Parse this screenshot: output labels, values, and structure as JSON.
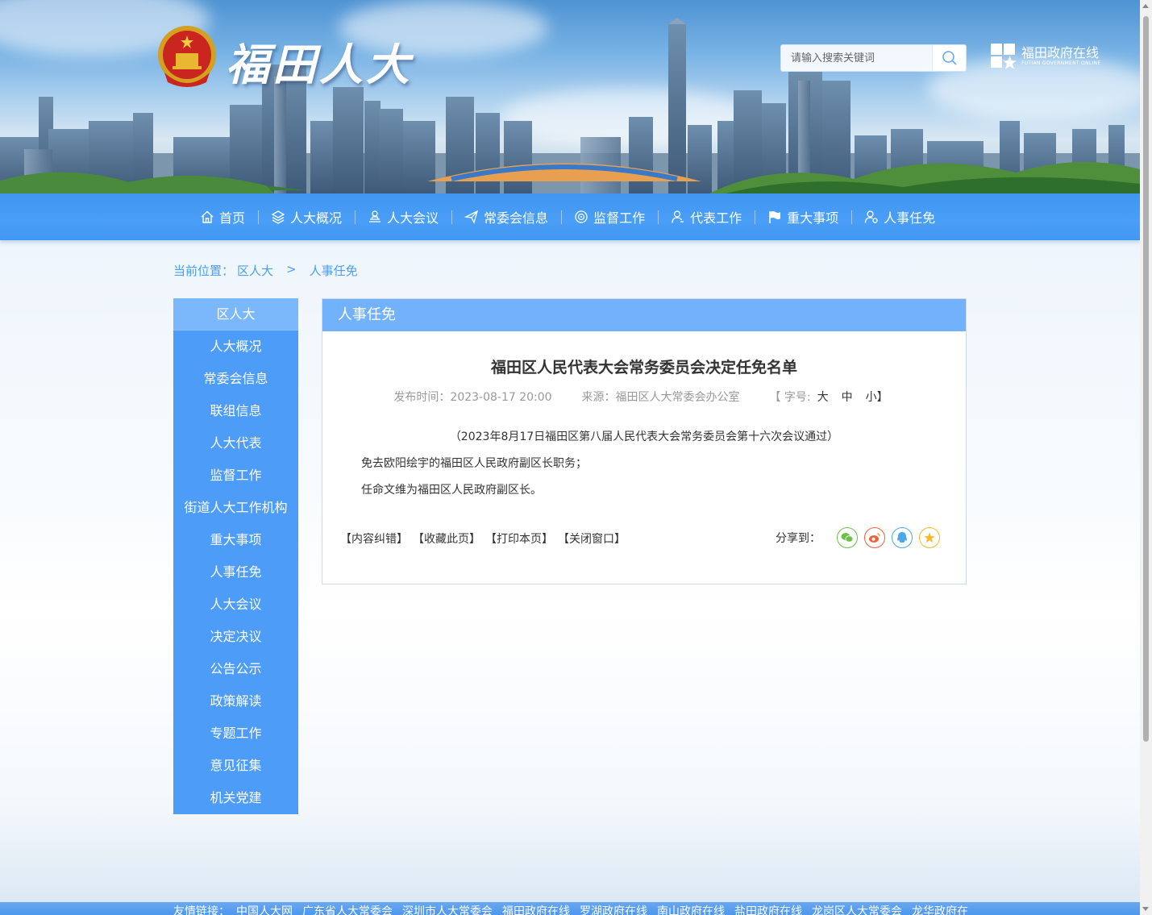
{
  "header": {
    "logo_text": "福田人大",
    "search": {
      "placeholder": "请输入搜索关键词"
    },
    "gov_logo": {
      "name": "福田政府在线",
      "subtitle": "FUTIAN GOVERNMENT ONLINE"
    }
  },
  "nav": [
    {
      "label": "首页",
      "icon": "home-icon"
    },
    {
      "label": "人大概况",
      "icon": "layers-icon"
    },
    {
      "label": "人大会议",
      "icon": "meeting-icon"
    },
    {
      "label": "常委会信息",
      "icon": "send-icon"
    },
    {
      "label": "监督工作",
      "icon": "eye-icon"
    },
    {
      "label": "代表工作",
      "icon": "user-icon"
    },
    {
      "label": "重大事项",
      "icon": "flag-icon"
    },
    {
      "label": "人事任免",
      "icon": "user-setting-icon"
    }
  ],
  "breadcrumb": {
    "prefix": "当前位置：",
    "items": [
      "区人大",
      "人事任免"
    ],
    "separator": ">"
  },
  "sidebar": {
    "title": "区人大",
    "items": [
      "人大概况",
      "常委会信息",
      "联组信息",
      "人大代表",
      "监督工作",
      "街道人大工作机构",
      "重大事项",
      "人事任免",
      "人大会议",
      "决定决议",
      "公告公示",
      "政策解读",
      "专题工作",
      "意见征集",
      "机关党建"
    ]
  },
  "article": {
    "section_title": "人事任免",
    "title": "福田区人民代表大会常务委员会决定任免名单",
    "meta": {
      "publish_label": "发布时间：",
      "publish_time": "2023-08-17 20:00",
      "source_label": "来源：",
      "source": "福田区人大常委会办公室",
      "font_label": "【 字号:",
      "font_large": "大",
      "font_medium": "中",
      "font_small": "小】"
    },
    "note": "（2023年8月17日福田区第八届人民代表大会常务委员会第十六次会议通过）",
    "paragraphs": [
      "免去欧阳绘宇的福田区人民政府副区长职务；",
      "任命文维为福田区人民政府副区长。"
    ],
    "actions": [
      "【内容纠错】",
      "【收藏此页】",
      "【打印本页】",
      "【关闭窗口】"
    ],
    "share_label": "分享到：",
    "share_icons": [
      {
        "name": "wechat-icon",
        "color": "#6cc04a"
      },
      {
        "name": "weibo-icon",
        "color": "#f0603a"
      },
      {
        "name": "qq-icon",
        "color": "#4aa8e8"
      },
      {
        "name": "favorite-star-icon",
        "color": "#f5b92a"
      }
    ]
  },
  "footer": {
    "label": "友情链接：",
    "links": [
      "中国人大网",
      "广东省人大常委会",
      "深圳市人大常委会",
      "福田政府在线",
      "罗湖政府在线",
      "南山政府在线",
      "盐田政府在线",
      "龙岗区人大常委会",
      "龙华政府在"
    ]
  },
  "colors": {
    "nav_bg": "#4a9ef7",
    "sidebar_bg": "#4c9cf8",
    "sidebar_active": "#7ab7fb",
    "content_bar": "#72b1fb",
    "breadcrumb": "#4a9ef5"
  }
}
